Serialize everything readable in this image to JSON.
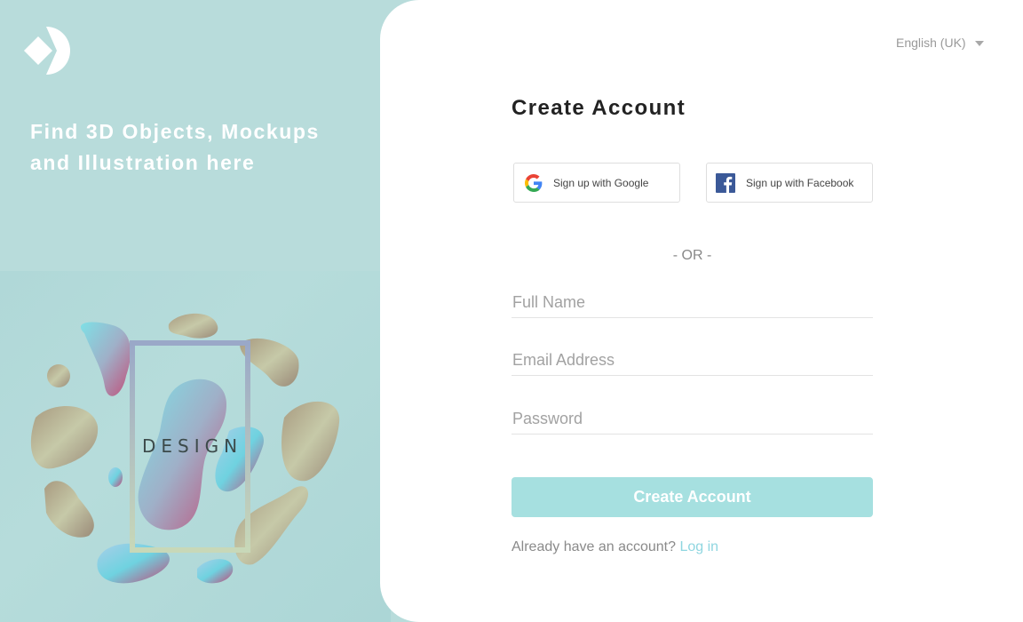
{
  "brand": {
    "tagline_line1": "Find 3D Objects, Mockups",
    "tagline_line2": "and Illustration here",
    "art_label": "DESIGN",
    "accent_color": "#a6e0e0",
    "panel_color": "#b8dcdb"
  },
  "language": {
    "selected": "English (UK)"
  },
  "form": {
    "title": "Create Account",
    "google_label": "Sign up with Google",
    "facebook_label": "Sign up with Facebook",
    "or_text": "- OR -",
    "full_name_placeholder": "Full Name",
    "email_placeholder": "Email Address",
    "password_placeholder": "Password",
    "submit_label": "Create Account",
    "already_text": "Already have an account?",
    "login_label": "Log in"
  },
  "icons": {
    "logo": "logo-icon",
    "google": "google-icon",
    "facebook": "facebook-icon",
    "caret": "chevron-down-icon"
  }
}
